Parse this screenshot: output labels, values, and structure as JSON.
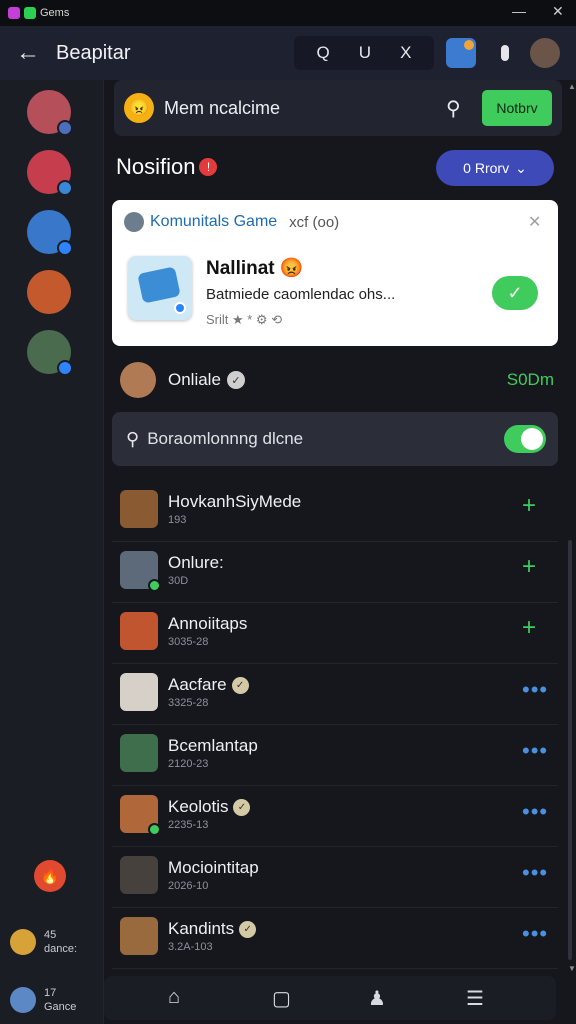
{
  "titlebar": {
    "app_name": "Gems",
    "minimize_glyph": "—",
    "close_glyph": "✕"
  },
  "header": {
    "back_glyph": "←",
    "title": "Beapitar",
    "tools": [
      "Q",
      "U",
      "X"
    ],
    "right_icons": [
      "avatar-icon",
      "mic-icon",
      "profile-icon"
    ]
  },
  "sidebar": {
    "avatars": [
      {
        "color": "#b5505a",
        "pip": "#4b6fbd"
      },
      {
        "color": "#c63d4d",
        "pip": "#3a86d8"
      },
      {
        "color": "#3877c9",
        "pip": "#2e83ff"
      },
      {
        "color": "#c4592d",
        "pip": null
      },
      {
        "color": "#4a6b4d",
        "pip": "#2e83ff"
      }
    ],
    "fire_badge": "🔥",
    "users": [
      {
        "line1": "45",
        "line2": "dance:"
      },
      {
        "line1": "17",
        "line2": "Gance"
      }
    ]
  },
  "topbar": {
    "emoji": "😠",
    "label": "Mem ncalcime",
    "search_glyph": "⚲",
    "action_label": "Notbrv"
  },
  "notifications": {
    "title": "Nosifion",
    "badge": "!",
    "filter_label": "0 Rrorv"
  },
  "card": {
    "community": "Komunitals Game",
    "community_suffix": "xcf (oo)",
    "close_glyph": "✕",
    "title": "Nallinat",
    "title_emoji": "😡",
    "description": "Batmiede caomlendac ohs...",
    "meta": "Srilt ★ * ⚙ ⟲",
    "check_glyph": "✓"
  },
  "online": {
    "name": "Onliale",
    "badge": "✓",
    "amount": "S0Dm"
  },
  "search": {
    "icon_glyph": "⚲",
    "text": "Boraomlonnng dlcne",
    "toggle_on": true
  },
  "list": [
    {
      "name": "HovkanhSiyMede",
      "sub": "193",
      "action": "plus",
      "avatar_color": "#8a5a32",
      "pip": false,
      "verified": false
    },
    {
      "name": "Onlure:",
      "sub": "30D",
      "action": "plus",
      "avatar_color": "#5d6a7a",
      "pip": true,
      "verified": false
    },
    {
      "name": "Annoiitaps",
      "sub": "3035-28",
      "action": "plus",
      "avatar_color": "#c0552f",
      "pip": false,
      "verified": false
    },
    {
      "name": "Aacfare",
      "sub": "3325-28",
      "action": "dots",
      "avatar_color": "#d6d0c8",
      "pip": false,
      "verified": true
    },
    {
      "name": "Bcemlantap",
      "sub": "2120-23",
      "action": "dots",
      "avatar_color": "#3f6e4c",
      "pip": false,
      "verified": false
    },
    {
      "name": "Keolotis",
      "sub": "2235-13",
      "action": "dots",
      "avatar_color": "#b0683b",
      "pip": true,
      "verified": true
    },
    {
      "name": "Mociointitap",
      "sub": "2026-10",
      "action": "dots",
      "avatar_color": "#47413d",
      "pip": false,
      "verified": false
    },
    {
      "name": "Kandints",
      "sub": "3.2A-103",
      "action": "dots",
      "avatar_color": "#9a6a3f",
      "pip": false,
      "verified": true
    }
  ],
  "list_action_glyphs": {
    "plus": "+",
    "dots": "•••"
  },
  "bottom_nav": [
    "⌂",
    "▢",
    "♟",
    "☰"
  ],
  "colors": {
    "accent_green": "#3fcc5d",
    "accent_blue": "#3d4ab7",
    "link_blue": "#4b8fe0",
    "bg": "#15171d"
  }
}
